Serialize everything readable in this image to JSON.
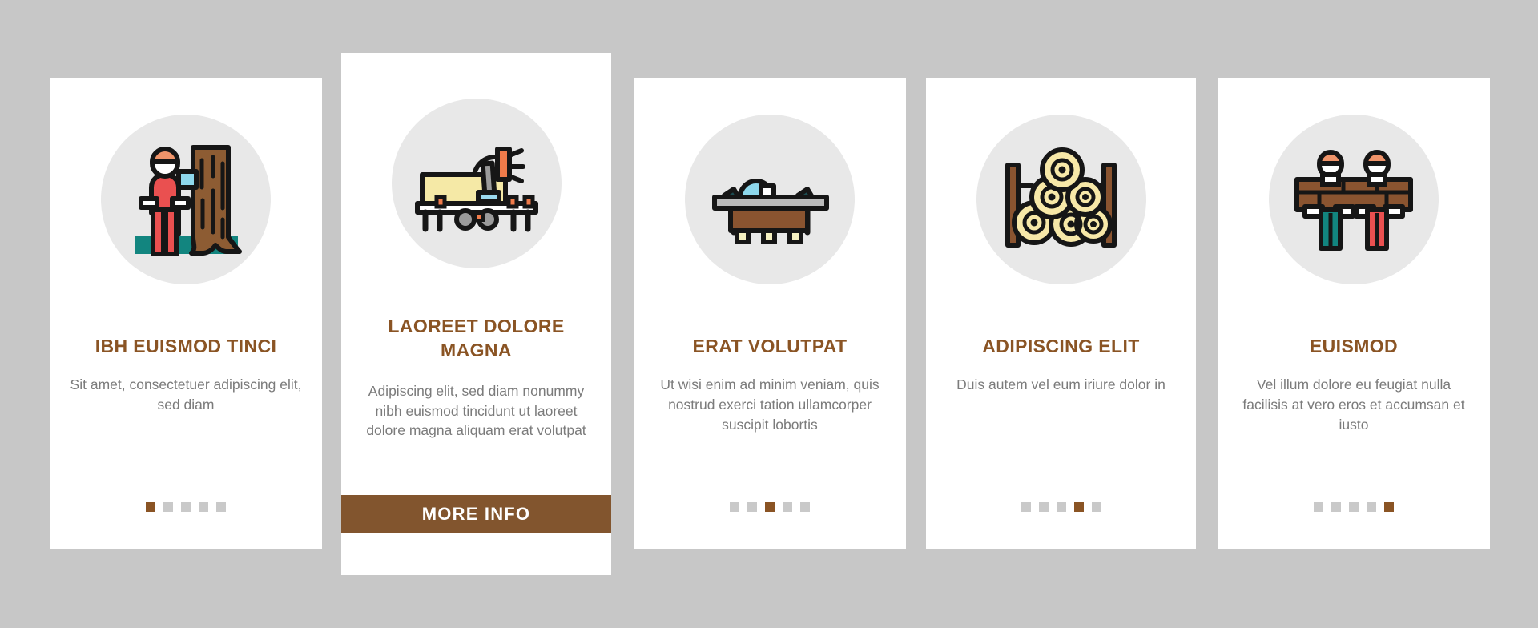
{
  "page": {
    "background_color": "#c7c7c7",
    "card_background": "#ffffff",
    "accent_color": "#8a5424",
    "button_color": "#82552e",
    "title_color": "#8a5424",
    "body_color": "#7b7b7b",
    "dot_inactive_color": "#c9c9c9",
    "icon_circle_color": "#e8e8e8"
  },
  "cards": [
    {
      "icon_name": "forester-with-flag-and-tree-trunk-icon",
      "title": "IBH EUISMOD TINCI",
      "body": "Sit amet, consectetuer adipiscing elit, sed diam",
      "dots_total": 5,
      "active_dot": 1,
      "has_button": false
    },
    {
      "icon_name": "log-loader-truck-icon",
      "title": "LAOREET DOLORE MAGNA",
      "body": "Adipiscing elit, sed diam nonummy nibh euismod tincidunt ut laoreet dolore magna aliquam erat volutpat",
      "dots_total": 0,
      "active_dot": 0,
      "has_button": true,
      "button_label": "MORE INFO"
    },
    {
      "icon_name": "sawmill-bench-saw-icon",
      "title": "ERAT VOLUTPAT",
      "body": "Ut wisi enim ad minim veniam, quis nostrud exerci tation ullamcorper suscipit lobortis",
      "dots_total": 5,
      "active_dot": 3,
      "has_button": false
    },
    {
      "icon_name": "stacked-logs-pile-icon",
      "title": "ADIPISCING ELIT",
      "body": "Duis autem vel eum iriure dolor in",
      "dots_total": 5,
      "active_dot": 4,
      "has_button": false
    },
    {
      "icon_name": "two-workers-carrying-planks-icon",
      "title": "EUISMOD",
      "body": "Vel illum dolore eu feugiat nulla facilisis at vero eros et accumsan et iusto",
      "dots_total": 5,
      "active_dot": 5,
      "has_button": false
    }
  ]
}
